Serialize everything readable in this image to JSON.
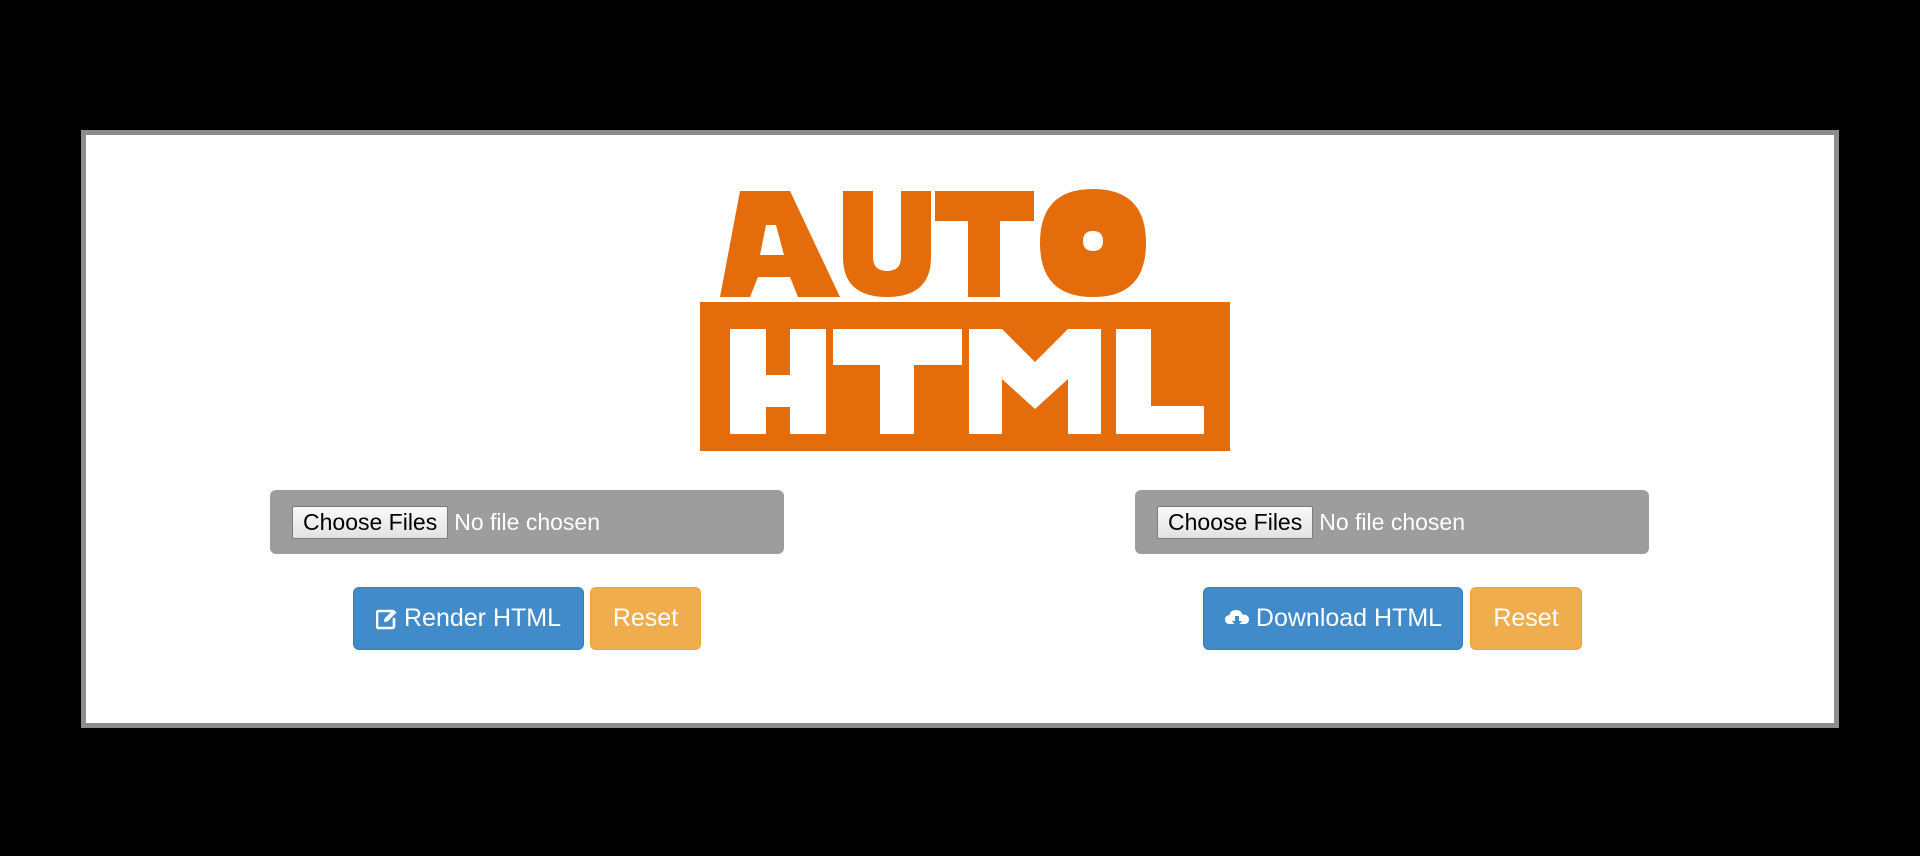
{
  "logo": {
    "text_top": "AUTO",
    "text_bottom": "HTML",
    "color": "#e46c0a"
  },
  "left_panel": {
    "choose_label": "Choose Files",
    "file_status": "No file chosen",
    "render_label": "Render HTML",
    "render_icon": "edit-icon",
    "reset_label": "Reset"
  },
  "right_panel": {
    "choose_label": "Choose Files",
    "file_status": "No file chosen",
    "download_label": "Download HTML",
    "download_icon": "cloud-download-icon",
    "reset_label": "Reset"
  },
  "colors": {
    "primary": "#428bca",
    "warning": "#f0ad4e",
    "file_box": "#9d9d9d",
    "panel_border": "#8c8c8c"
  }
}
